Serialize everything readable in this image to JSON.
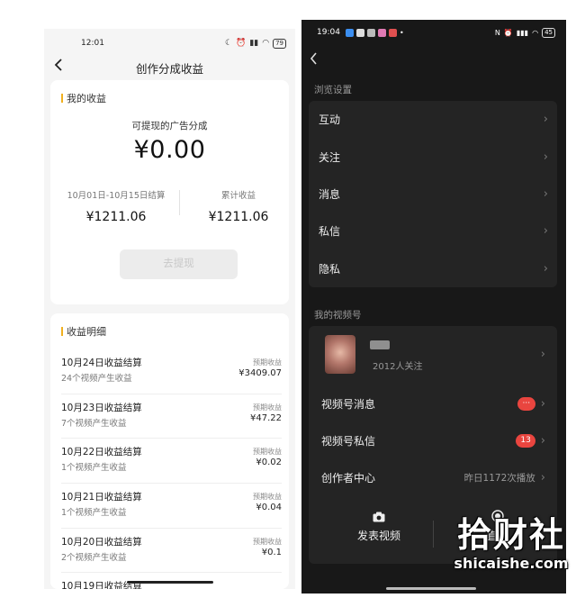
{
  "left": {
    "status": {
      "time": "12:01",
      "battery": "79"
    },
    "nav": {
      "title": "创作分成收益"
    },
    "earnings_card": {
      "section_title": "我的收益",
      "withdrawable_label": "可提现的广告分成",
      "withdrawable_amount": "¥0.00",
      "period_label": "10月01日-10月15日结算",
      "period_amount": "¥1211.06",
      "total_label": "累计收益",
      "total_amount": "¥1211.06",
      "withdraw_button": "去提现"
    },
    "details_card": {
      "section_title": "收益明细",
      "rows": [
        {
          "title": "10月24日收益结算",
          "sub": "24个视频产生收益",
          "label": "预期收益",
          "value": "¥3409.07"
        },
        {
          "title": "10月23日收益结算",
          "sub": "7个视频产生收益",
          "label": "预期收益",
          "value": "¥47.22"
        },
        {
          "title": "10月22日收益结算",
          "sub": "1个视频产生收益",
          "label": "预期收益",
          "value": "¥0.02"
        },
        {
          "title": "10月21日收益结算",
          "sub": "1个视频产生收益",
          "label": "预期收益",
          "value": "¥0.04"
        },
        {
          "title": "10月20日收益结算",
          "sub": "2个视频产生收益",
          "label": "预期收益",
          "value": "¥0.1"
        },
        {
          "title": "10月19日收益结算",
          "sub": "",
          "label": "",
          "value": ""
        }
      ]
    }
  },
  "right": {
    "status": {
      "time": "19:04",
      "battery": "45"
    },
    "browse_header": "浏览设置",
    "browse_items": [
      "互动",
      "关注",
      "消息",
      "私信",
      "隐私"
    ],
    "channel_header": "我的视频号",
    "profile": {
      "followers": "2012人关注"
    },
    "channel_items": [
      {
        "label": "视频号消息",
        "badge": "···",
        "note": ""
      },
      {
        "label": "视频号私信",
        "badge": "13",
        "note": ""
      },
      {
        "label": "创作者中心",
        "badge": "",
        "note": "昨日1172次播放"
      }
    ],
    "bottom": {
      "post_label": "发表视频",
      "live_label": "直播"
    }
  },
  "watermark": {
    "cn": "拾财社",
    "en": "shicaishe.com"
  },
  "icons": {
    "back": "chevron-left-icon",
    "chevron": "chevron-right-icon",
    "camera": "camera-icon",
    "live": "live-icon"
  },
  "colors": {
    "accent_bar": "#f0b020",
    "badge_red": "#e9453f",
    "dark_bg": "#181818"
  }
}
